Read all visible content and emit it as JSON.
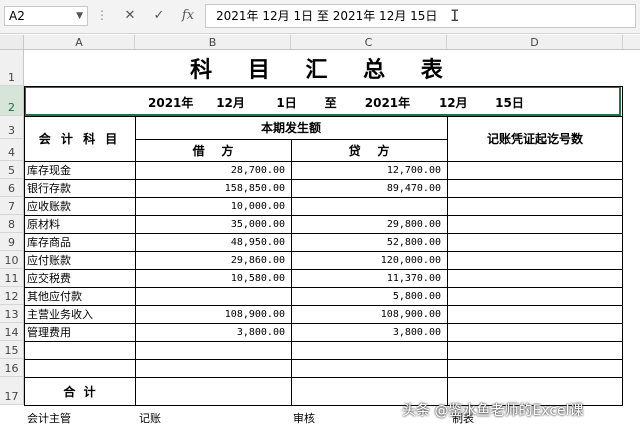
{
  "formula_bar": {
    "name_box": "A2",
    "cancel_icon": "✕",
    "enter_icon": "✓",
    "fx_label": "fx",
    "content": "2021年  12月  1日  至  2021年  12月  15日"
  },
  "columns": [
    "A",
    "B",
    "C",
    "D"
  ],
  "rows": [
    "1",
    "2",
    "3",
    "4",
    "5",
    "6",
    "7",
    "8",
    "9",
    "10",
    "11",
    "12",
    "13",
    "14",
    "15",
    "16",
    "17"
  ],
  "sheet": {
    "title": "科 目 汇 总 表",
    "date_range": {
      "from_year": "2021年",
      "from_month": "12月",
      "from_day": "1日",
      "to": "至",
      "to_year": "2021年",
      "to_month": "12月",
      "to_day": "15日"
    },
    "header": {
      "account": "会 计 科 目",
      "period_amount": "本期发生额",
      "debit": "借    方",
      "credit": "贷    方",
      "voucher_range": "记账凭证起讫号数"
    },
    "items": [
      {
        "name": "库存现金",
        "debit": "28,700.00",
        "credit": "12,700.00"
      },
      {
        "name": "银行存款",
        "debit": "158,850.00",
        "credit": "89,470.00"
      },
      {
        "name": "应收账款",
        "debit": "10,000.00",
        "credit": ""
      },
      {
        "name": "原材料",
        "debit": "35,000.00",
        "credit": "29,800.00"
      },
      {
        "name": "库存商品",
        "debit": "48,950.00",
        "credit": "52,800.00"
      },
      {
        "name": "应付账款",
        "debit": "29,860.00",
        "credit": "120,000.00"
      },
      {
        "name": "应交税费",
        "debit": "10,580.00",
        "credit": "11,370.00"
      },
      {
        "name": "其他应付款",
        "debit": "",
        "credit": "5,800.00"
      },
      {
        "name": "主营业务收入",
        "debit": "108,900.00",
        "credit": "108,900.00"
      },
      {
        "name": "管理费用",
        "debit": "3,800.00",
        "credit": "3,800.00"
      },
      {
        "name": "",
        "debit": "",
        "credit": ""
      },
      {
        "name": "",
        "debit": "",
        "credit": ""
      }
    ],
    "total_label": "合  计",
    "footer": {
      "supervisor": "会计主管",
      "bookkeeper": "记账",
      "reviewer": "审核",
      "preparer": "制表"
    }
  },
  "watermark": "头条 @鉴水鱼老师的Excel课"
}
